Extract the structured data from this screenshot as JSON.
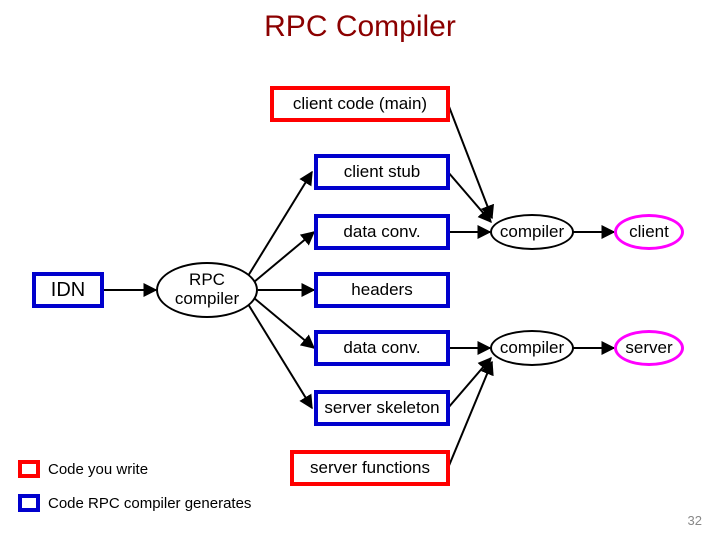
{
  "title": "RPC Compiler",
  "boxes": {
    "client_code": "client code (main)",
    "client_stub": "client stub",
    "data_conv_1": "data conv.",
    "headers": "headers",
    "data_conv_2": "data conv.",
    "server_skeleton": "server skeleton",
    "server_functions": "server functions",
    "idn": "IDN"
  },
  "ellipses": {
    "rpc_compiler": "RPC\ncompiler",
    "compiler_1": "compiler",
    "compiler_2": "compiler",
    "client": "client",
    "server": "server"
  },
  "legend": {
    "you_write": "Code you write",
    "generates": "Code RPC compiler generates"
  },
  "page_number": "32"
}
